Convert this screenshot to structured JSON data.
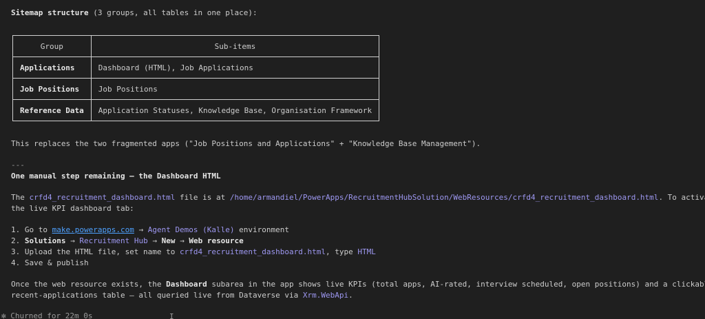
{
  "heading": {
    "bold": "Sitemap structure",
    "rest": " (3 groups, all tables in one place):"
  },
  "table": {
    "headers": [
      "Group",
      "Sub-items"
    ],
    "rows": [
      {
        "group": "Applications",
        "items": "Dashboard (HTML), Job Applications"
      },
      {
        "group": "Job Positions",
        "items": "Job Positions"
      },
      {
        "group": "Reference Data",
        "items": "Application Statuses, Knowledge Base, Organisation Framework"
      }
    ]
  },
  "replaces_text": "This replaces the two fragmented apps (\"Job Positions and Applications\" + \"Knowledge Base Management\").",
  "separator": "---",
  "manual_step_heading": "One manual step remaining — the Dashboard HTML",
  "para1": {
    "t1": "The ",
    "file": "crfd4_recruitment_dashboard.html",
    "t2": " file is at ",
    "path": "/home/armandiel/PowerApps/RecruitmentHubSolution/WebResources/crfd4_recruitment_dashboard.html",
    "t3": ". To activate",
    "line2": "the live KPI dashboard tab:"
  },
  "steps": {
    "s1": {
      "num": "1. Go to ",
      "link": "make.powerapps.com",
      "arrow": " → ",
      "env": "Agent Demos (Kalle)",
      "rest": " environment"
    },
    "s2": {
      "num": "2. ",
      "solutions": "Solutions",
      "a1": " → ",
      "hub": "Recruitment Hub",
      "a2": " → ",
      "new": "New",
      "a3": " → ",
      "web": "Web resource"
    },
    "s3": {
      "t1": "3. Upload the HTML file, set name to ",
      "name": "crfd4_recruitment_dashboard.html",
      "t2": ", type ",
      "type": "HTML"
    },
    "s4": "4. Save & publish"
  },
  "para2": {
    "t1": "Once the web resource exists, the ",
    "dash": "Dashboard",
    "t2": " subarea in the app shows live KPIs (total apps, AI-rated, interview scheduled, open positions) and a clickable",
    "line2a": "recent-applications table — all queried live from Dataverse via ",
    "api": "Xrm.WebApi",
    "line2b": "."
  },
  "footer": "✻ Churned for 22m 0s",
  "cursor": "I"
}
